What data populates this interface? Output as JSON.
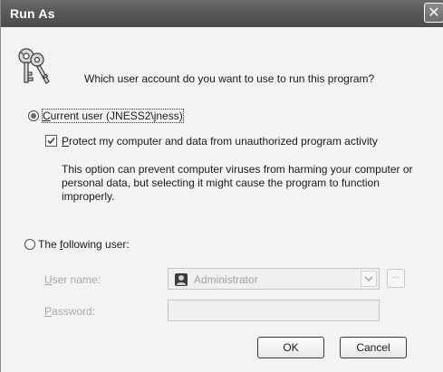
{
  "window": {
    "title": "Run As",
    "close_glyph": "✕"
  },
  "prompt": {
    "question": "Which user account do you want to use to run this program?",
    "icon": "keys-icon"
  },
  "current_user": {
    "label_prefix": "",
    "label_accel": "C",
    "label_rest": "urrent user (JNESS2\\jness)",
    "selected": true
  },
  "protect": {
    "label_accel": "P",
    "label_rest": "rotect my computer and data from unauthorized program activity",
    "checked": true,
    "description": "This option can prevent computer viruses from harming your computer or personal data, but selecting it might cause the program to function improperly."
  },
  "following_user": {
    "label_prefix": "The ",
    "label_accel": "f",
    "label_rest": "ollowing user:",
    "selected": false
  },
  "username": {
    "label_accel": "U",
    "label_rest": "ser name:",
    "value": "Administrator",
    "icon": "user-icon"
  },
  "browse": {
    "label": "..."
  },
  "password": {
    "label_accel": "P",
    "label_rest": "assword:",
    "value": ""
  },
  "buttons": {
    "ok": "OK",
    "cancel": "Cancel"
  }
}
